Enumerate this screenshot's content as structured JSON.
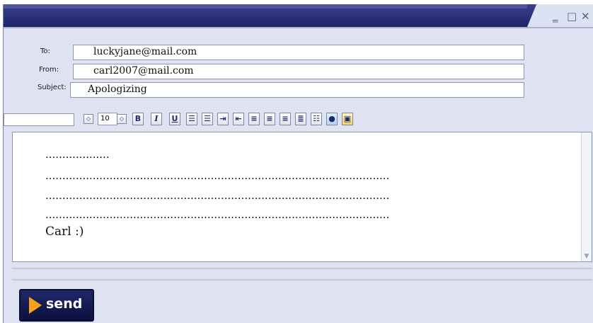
{
  "window": {
    "minimize_glyph": "‗",
    "maximize_glyph": "□",
    "close_glyph": "✕"
  },
  "form": {
    "to_label": "To:",
    "to_value": "luckyjane@mail.com",
    "from_label": "From:",
    "from_value": "carl2007@mail.com",
    "subject_label": "Subject:",
    "subject_value": "Apologizing"
  },
  "toolbar": {
    "font_size": "10",
    "bold": "B",
    "italic": "I",
    "underline": "U"
  },
  "body": {
    "lines": [
      "...................",
      "......................................................................................................",
      "......................................................................................................",
      "......................................................................................................",
      "Carl :)"
    ]
  },
  "send_label": "send"
}
